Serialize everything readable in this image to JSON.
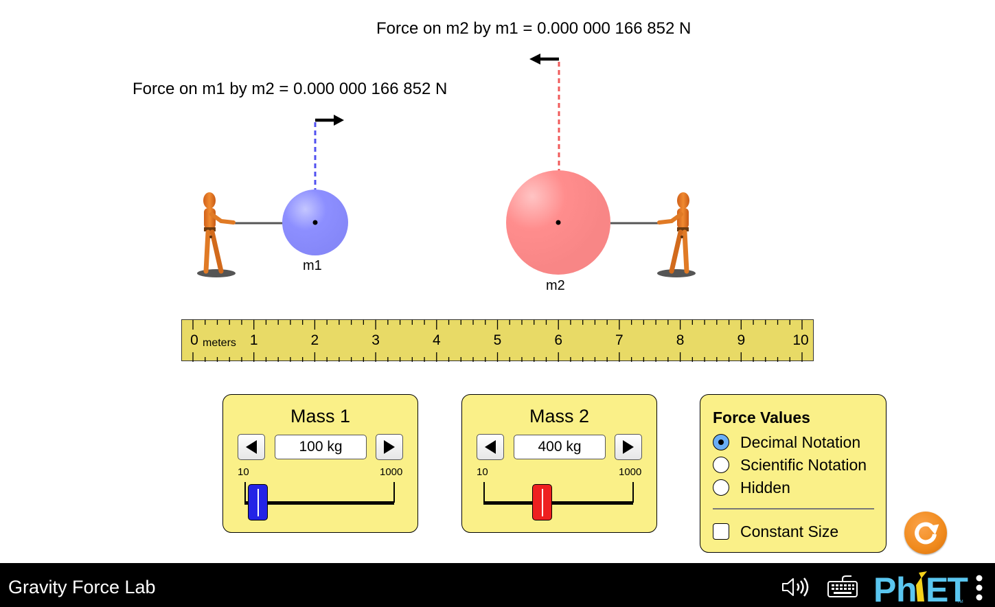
{
  "app": {
    "title": "Gravity Force Lab"
  },
  "forces": {
    "on_m2_by_m1": "Force on m2 by m1 = 0.000 000 166 852 N",
    "on_m1_by_m2": "Force on m1 by m2 = 0.000 000 166 852 N"
  },
  "masses": {
    "m1": {
      "label": "m1",
      "color": "#8a8cff",
      "position_m": 2.0
    },
    "m2": {
      "label": "m2",
      "color": "#ff8a8a",
      "position_m": 6.0
    }
  },
  "ruler": {
    "units": "meters",
    "ticks": [
      "0",
      "1",
      "2",
      "3",
      "4",
      "5",
      "6",
      "7",
      "8",
      "9",
      "10"
    ],
    "background": "#e8da66"
  },
  "mass1_control": {
    "title": "Mass 1",
    "value": "100 kg",
    "min_label": "10",
    "max_label": "1000",
    "value_kg": 100,
    "min_kg": 10,
    "max_kg": 1000,
    "thumb_color": "#2323e6"
  },
  "mass2_control": {
    "title": "Mass 2",
    "value": "400 kg",
    "min_label": "10",
    "max_label": "1000",
    "value_kg": 400,
    "min_kg": 10,
    "max_kg": 1000,
    "thumb_color": "#ee2020"
  },
  "force_values_panel": {
    "title": "Force Values",
    "options": [
      {
        "label": "Decimal Notation",
        "selected": true
      },
      {
        "label": "Scientific Notation",
        "selected": false
      },
      {
        "label": "Hidden",
        "selected": false
      }
    ],
    "constant_size": {
      "label": "Constant Size",
      "checked": false
    }
  },
  "navbar": {
    "icons": [
      "sound-icon",
      "keyboard-icon",
      "phet-logo",
      "menu-icon"
    ],
    "logo_text": "PhET",
    "logo_color": "#5ac6f0",
    "logo_accent": "#f5d21b"
  },
  "colors": {
    "panel_bg": "#faf088",
    "reset_orange": "#f08a1c"
  }
}
